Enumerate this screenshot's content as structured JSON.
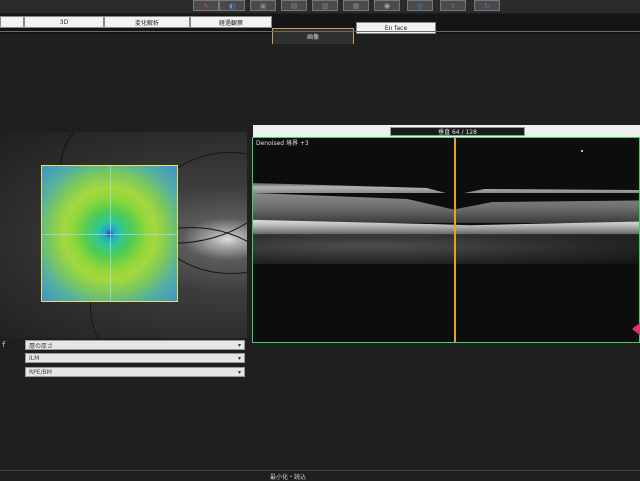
{
  "toolbar": {
    "buttons": [
      {
        "icon": "tools-icon",
        "glyph": "✎",
        "color": "#c8502e"
      },
      {
        "icon": "globe-icon",
        "glyph": "◐",
        "color": "#5a8fd0"
      },
      {
        "icon": "window-icon",
        "glyph": "▣",
        "color": "#888888"
      },
      {
        "icon": "window-icon",
        "glyph": "▤",
        "color": "#888888"
      },
      {
        "icon": "window-icon",
        "glyph": "▥",
        "color": "#888888"
      },
      {
        "icon": "window-icon",
        "glyph": "▦",
        "color": "#888888"
      },
      {
        "icon": "camera-icon",
        "glyph": "◉",
        "color": "#aaaaaa"
      },
      {
        "icon": "eye-icon",
        "glyph": "◎",
        "color": "#3a80c8"
      },
      {
        "icon": "export-icon",
        "glyph": "⇪",
        "color": "#3aa060"
      },
      {
        "icon": "refresh-icon",
        "glyph": "↻",
        "color": "#3a80c8"
      }
    ]
  },
  "tabs": [
    {
      "label": "",
      "active": false
    },
    {
      "label": "3D",
      "active": false
    },
    {
      "label": "変化解析",
      "active": false
    },
    {
      "label": "経過観察",
      "active": false
    },
    {
      "label": "画像",
      "active": true
    },
    {
      "label": "En face",
      "active": false
    }
  ],
  "oct": {
    "scan_label": "Denoised 境界 +3",
    "slice_text": "垂直 64 / 128"
  },
  "dropdowns": [
    {
      "value": "層の厚さ"
    },
    {
      "value": "ILM"
    },
    {
      "value": "RPE/BM"
    }
  ],
  "bottom": {
    "text": "最小化・読込"
  },
  "colors": {
    "accent_cursor": "#e8a020",
    "frame_green": "#3ad26a",
    "heatmap_border": "#e8e060",
    "marker_pink": "#e0307a"
  }
}
